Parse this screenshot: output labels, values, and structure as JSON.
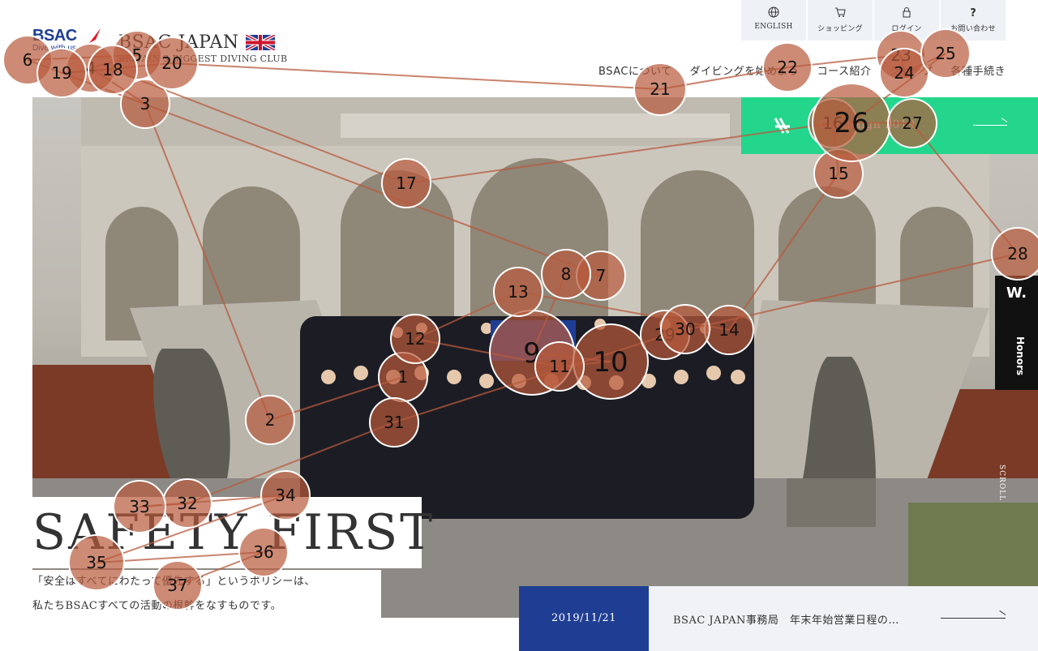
{
  "header": {
    "logo_text": "BSAC",
    "logo_tagline": "Dive with us",
    "site_title": "BSAC JAPAN",
    "site_subtitle": "BRITAIN'S BIGGEST DIVING CLUB"
  },
  "utility_nav": [
    {
      "label": "ENGLISH",
      "icon": "globe-icon"
    },
    {
      "label": "ショッピング",
      "icon": "cart-icon"
    },
    {
      "label": "ログイン",
      "icon": "lock-icon"
    },
    {
      "label": "お問い合わせ",
      "icon": "question-icon"
    }
  ],
  "main_nav": [
    {
      "label": "BSACについて"
    },
    {
      "label": "ダイビングを始めよう"
    },
    {
      "label": "コース紹介"
    },
    {
      "label": "ショップ"
    },
    {
      "label": "各種手続き"
    }
  ],
  "campaign": {
    "label": "Campaign 2019"
  },
  "honors": {
    "label": "Honors",
    "badge": "W."
  },
  "scroll": "SCROLL",
  "hero": {
    "title": "SAFETY FIRST",
    "lines": [
      "「安全はすべてにわたって優先する」というポリシーは、",
      "私たちBSACすべての活動の根幹をなすものです。"
    ]
  },
  "news": {
    "date": "2019/11/21",
    "title": "BSAC JAPAN事務局　年末年始営業日程の…"
  },
  "colors": {
    "brand_blue": "#1f3e93",
    "campaign_green": "#23d68c",
    "marker": "#b85a3c"
  },
  "markers": [
    {
      "n": "1"
    },
    {
      "n": "2"
    },
    {
      "n": "3"
    },
    {
      "n": "4"
    },
    {
      "n": "5"
    },
    {
      "n": "6"
    },
    {
      "n": "7"
    },
    {
      "n": "8"
    },
    {
      "n": "9"
    },
    {
      "n": "10"
    },
    {
      "n": "11"
    },
    {
      "n": "12"
    },
    {
      "n": "13"
    },
    {
      "n": "14"
    },
    {
      "n": "15"
    },
    {
      "n": "16"
    },
    {
      "n": "17"
    },
    {
      "n": "18"
    },
    {
      "n": "19"
    },
    {
      "n": "20"
    },
    {
      "n": "21"
    },
    {
      "n": "22"
    },
    {
      "n": "23"
    },
    {
      "n": "24"
    },
    {
      "n": "25"
    },
    {
      "n": "26"
    },
    {
      "n": "27"
    },
    {
      "n": "28"
    },
    {
      "n": "29"
    },
    {
      "n": "30"
    },
    {
      "n": "31"
    },
    {
      "n": "32"
    },
    {
      "n": "33"
    },
    {
      "n": "34"
    },
    {
      "n": "35"
    },
    {
      "n": "36"
    },
    {
      "n": "37"
    }
  ]
}
